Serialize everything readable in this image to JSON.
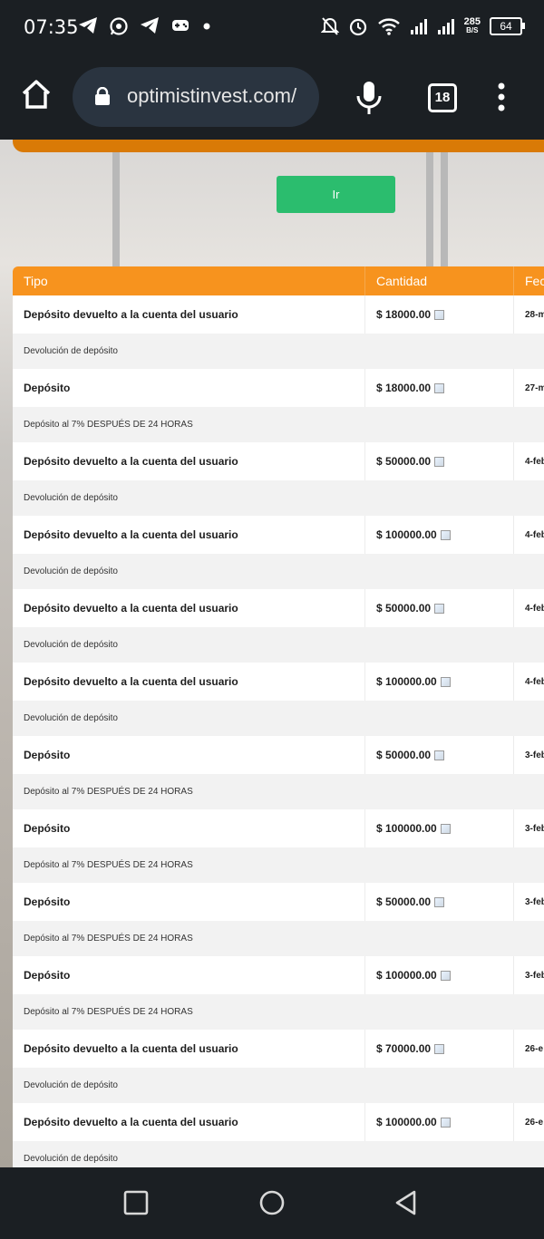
{
  "status_bar": {
    "time": "07:35",
    "left_icons": [
      "telegram-icon",
      "whatsapp-icon",
      "telegram-icon",
      "game-controller-icon",
      "dot-icon"
    ],
    "right_icons": [
      "mute-bell-icon",
      "alarm-icon",
      "wifi-icon",
      "signal-icon",
      "signal-icon"
    ],
    "speed_value": "285",
    "speed_unit": "B/S",
    "battery": "64"
  },
  "browser": {
    "url": "optimistinvest.com/",
    "tab_count": "18"
  },
  "page": {
    "ir_button": "Ir",
    "table": {
      "headers": [
        "Tipo",
        "Cantidad",
        "Fec"
      ],
      "rows": [
        {
          "tipo": "Depósito devuelto a la cuenta del usuario",
          "cantidad": "$ 18000.00",
          "fecha": "28-m",
          "detalle": "Devolución de depósito"
        },
        {
          "tipo": "Depósito",
          "cantidad": "$ 18000.00",
          "fecha": "27-m",
          "detalle": "Depósito al 7% DESPUÉS DE 24 HORAS"
        },
        {
          "tipo": "Depósito devuelto a la cuenta del usuario",
          "cantidad": "$ 50000.00",
          "fecha": "4-feb",
          "detalle": "Devolución de depósito"
        },
        {
          "tipo": "Depósito devuelto a la cuenta del usuario",
          "cantidad": "$ 100000.00",
          "fecha": "4-feb",
          "detalle": "Devolución de depósito"
        },
        {
          "tipo": "Depósito devuelto a la cuenta del usuario",
          "cantidad": "$ 50000.00",
          "fecha": "4-feb",
          "detalle": "Devolución de depósito"
        },
        {
          "tipo": "Depósito devuelto a la cuenta del usuario",
          "cantidad": "$ 100000.00",
          "fecha": "4-feb",
          "detalle": "Devolución de depósito"
        },
        {
          "tipo": "Depósito",
          "cantidad": "$ 50000.00",
          "fecha": "3-feb",
          "detalle": "Depósito al 7% DESPUÉS DE 24 HORAS"
        },
        {
          "tipo": "Depósito",
          "cantidad": "$ 100000.00",
          "fecha": "3-feb",
          "detalle": "Depósito al 7% DESPUÉS DE 24 HORAS"
        },
        {
          "tipo": "Depósito",
          "cantidad": "$ 50000.00",
          "fecha": "3-feb",
          "detalle": "Depósito al 7% DESPUÉS DE 24 HORAS"
        },
        {
          "tipo": "Depósito",
          "cantidad": "$ 100000.00",
          "fecha": "3-feb",
          "detalle": "Depósito al 7% DESPUÉS DE 24 HORAS"
        },
        {
          "tipo": "Depósito devuelto a la cuenta del usuario",
          "cantidad": "$ 70000.00",
          "fecha": "26-e",
          "detalle": "Devolución de depósito"
        },
        {
          "tipo": "Depósito devuelto a la cuenta del usuario",
          "cantidad": "$ 100000.00",
          "fecha": "26-e",
          "detalle": "Devolución de depósito"
        }
      ]
    }
  },
  "nav_bar": [
    "recents-square-icon",
    "home-circle-icon",
    "back-triangle-icon"
  ],
  "colors": {
    "header_orange": "#f7931e",
    "strip_orange": "#d97a06",
    "button_green": "#2bbd6e",
    "chrome_dark": "#1b1f23"
  }
}
